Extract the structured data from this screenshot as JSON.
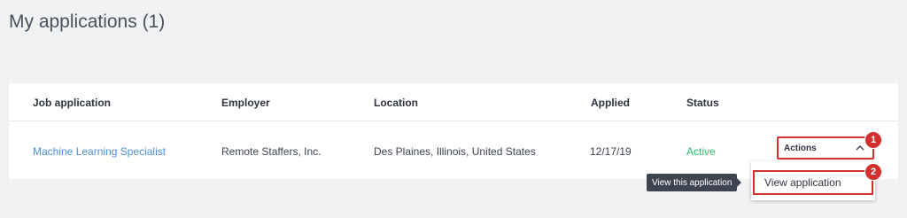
{
  "page": {
    "title": "My applications (1)"
  },
  "table": {
    "headers": {
      "job": "Job application",
      "employer": "Employer",
      "location": "Location",
      "applied": "Applied",
      "status": "Status"
    },
    "rows": [
      {
        "job": "Machine Learning Specialist",
        "employer": "Remote Staffers, Inc.",
        "location": "Des Plaines, Illinois, United States",
        "applied": "12/17/19",
        "status": "Active"
      }
    ]
  },
  "actions": {
    "label": "Actions",
    "icon": "chevron-up-icon",
    "menu": [
      {
        "label": "View application"
      }
    ]
  },
  "tooltip": {
    "text": "View this application"
  },
  "annotations": {
    "badge1": "1",
    "badge2": "2"
  },
  "colors": {
    "link": "#4a90d9",
    "status_active": "#2ebf6d",
    "highlight": "#d32f2f",
    "tooltip_bg": "#3e4450"
  }
}
